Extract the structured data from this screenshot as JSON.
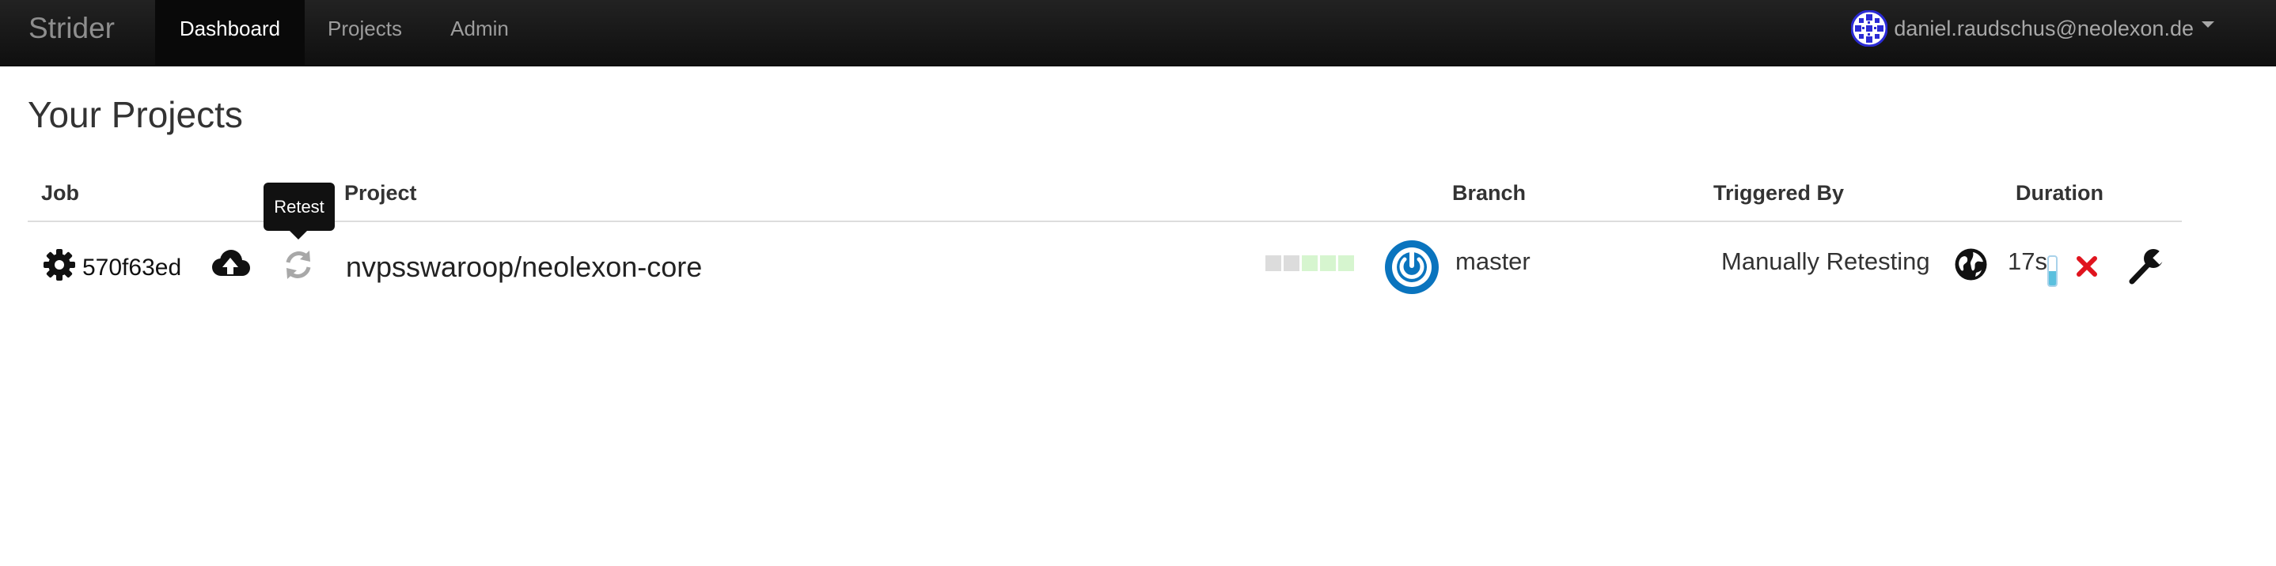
{
  "navbar": {
    "brand": "Strider",
    "items": [
      {
        "label": "Dashboard",
        "active": true
      },
      {
        "label": "Projects",
        "active": false
      },
      {
        "label": "Admin",
        "active": false
      }
    ],
    "user_email": "daniel.raudschus@neolexon.de"
  },
  "page_title": "Your Projects",
  "table": {
    "headers": {
      "job": "Job",
      "project": "Project",
      "branch": "Branch",
      "triggered_by": "Triggered By",
      "duration": "Duration"
    },
    "rows": [
      {
        "job_id": "570f63ed",
        "project": "nvpsswaroop/neolexon-core",
        "branch": "master",
        "triggered_by": "Manually Retesting",
        "duration": "17s",
        "history": [
          "#dcdcdc",
          "#dcdcdc",
          "#d6f5cf",
          "#d6f5cf",
          "#d6f5cf"
        ],
        "progress": 0.5,
        "icons": [
          "gear-icon",
          "cloud-upload-icon",
          "refresh-icon",
          "power-icon",
          "globe-icon",
          "remove-icon",
          "wrench-icon"
        ]
      }
    ]
  },
  "tooltip": "Retest",
  "colors": {
    "navbar_bg": "#1b1b1b",
    "power_blue": "#0a74be",
    "remove_red": "#e0141e",
    "progress_blue": "#5bc0de",
    "success_green": "#d6f5cf"
  }
}
